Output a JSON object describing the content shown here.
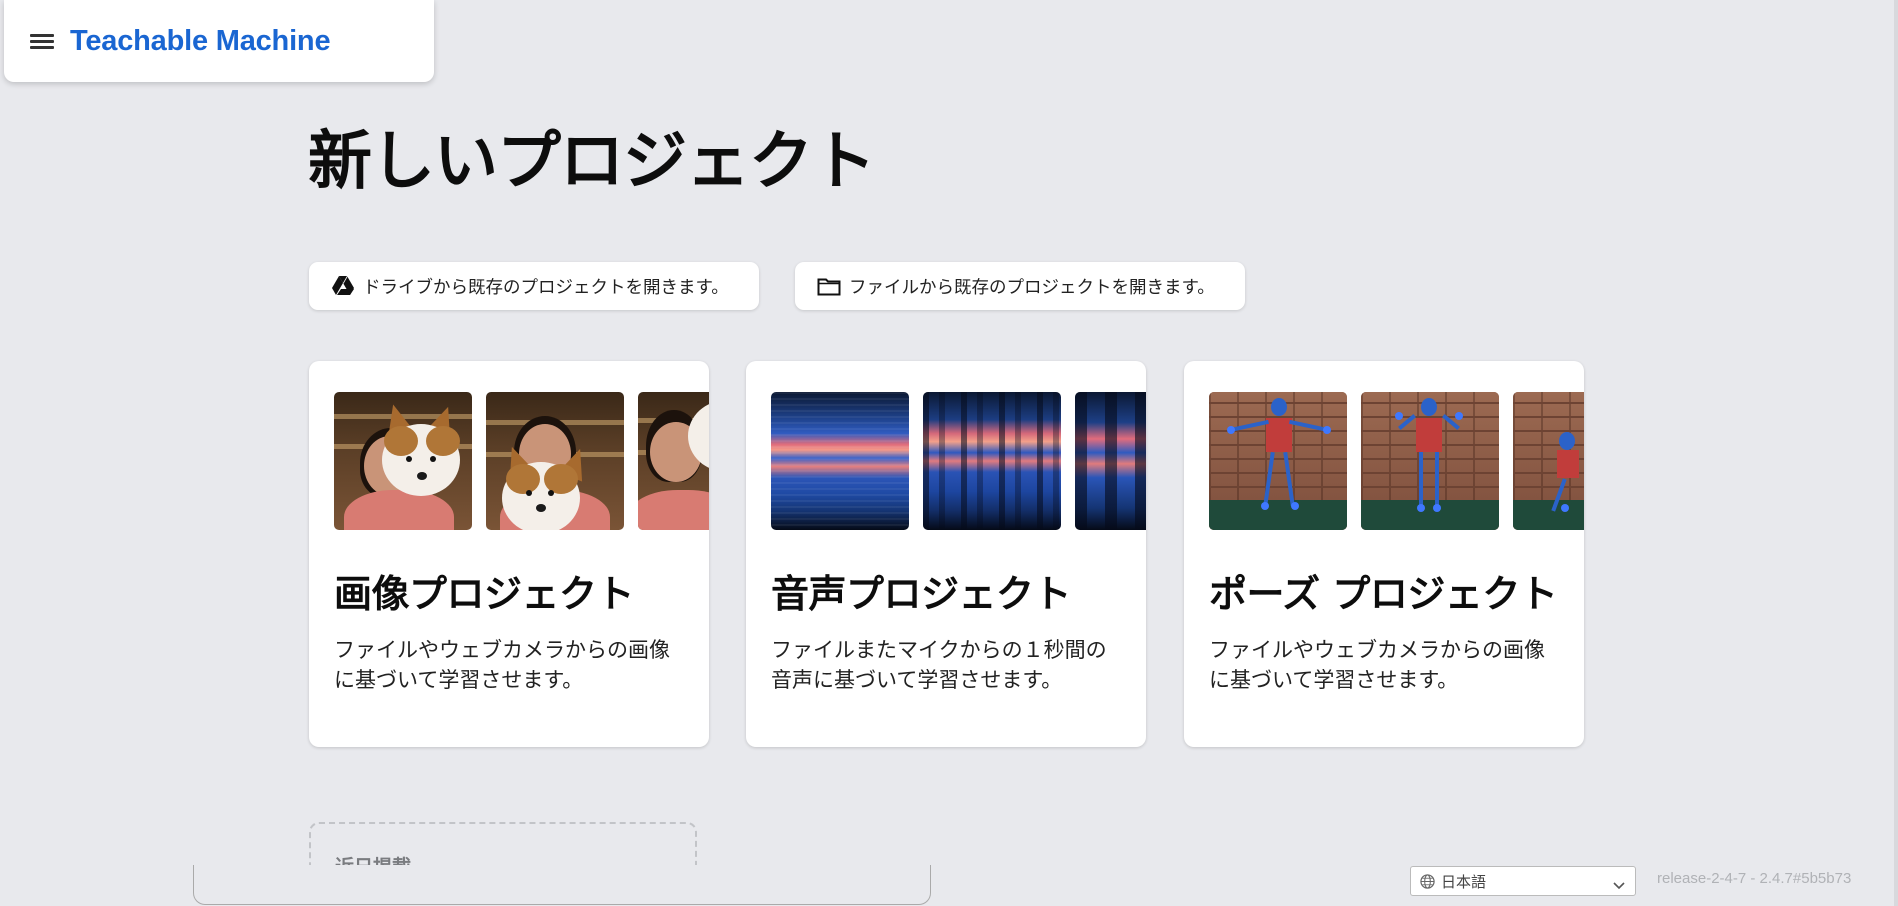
{
  "header": {
    "app_title": "Teachable Machine",
    "menu_icon": "hamburger-menu-icon"
  },
  "page": {
    "title": "新しいプロジェクト"
  },
  "open_buttons": {
    "drive": {
      "label": "ドライブから既存のプロジェクトを開きます。",
      "icon": "google-drive-icon"
    },
    "file": {
      "label": "ファイルから既存のプロジェクトを開きます。",
      "icon": "folder-icon"
    }
  },
  "projects": [
    {
      "title": "画像プロジェクト",
      "description": "ファイルやウェブカメラからの画像に基づいて学習させます。"
    },
    {
      "title": "音声プロジェクト",
      "description": "ファイルまたマイクからの１秒間の音声に基づいて学習させます。"
    },
    {
      "title": "ポーズ プロジェクト",
      "description": "ファイルやウェブカメラからの画像に基づいて学習させます。"
    }
  ],
  "recent": {
    "label": "近日掲載"
  },
  "footer": {
    "language": "日本語",
    "version": "release-2-4-7 - 2.4.7#5b5b73"
  },
  "colors": {
    "brand": "#1a66d2",
    "background": "#e8e9ed",
    "card": "#ffffff"
  }
}
